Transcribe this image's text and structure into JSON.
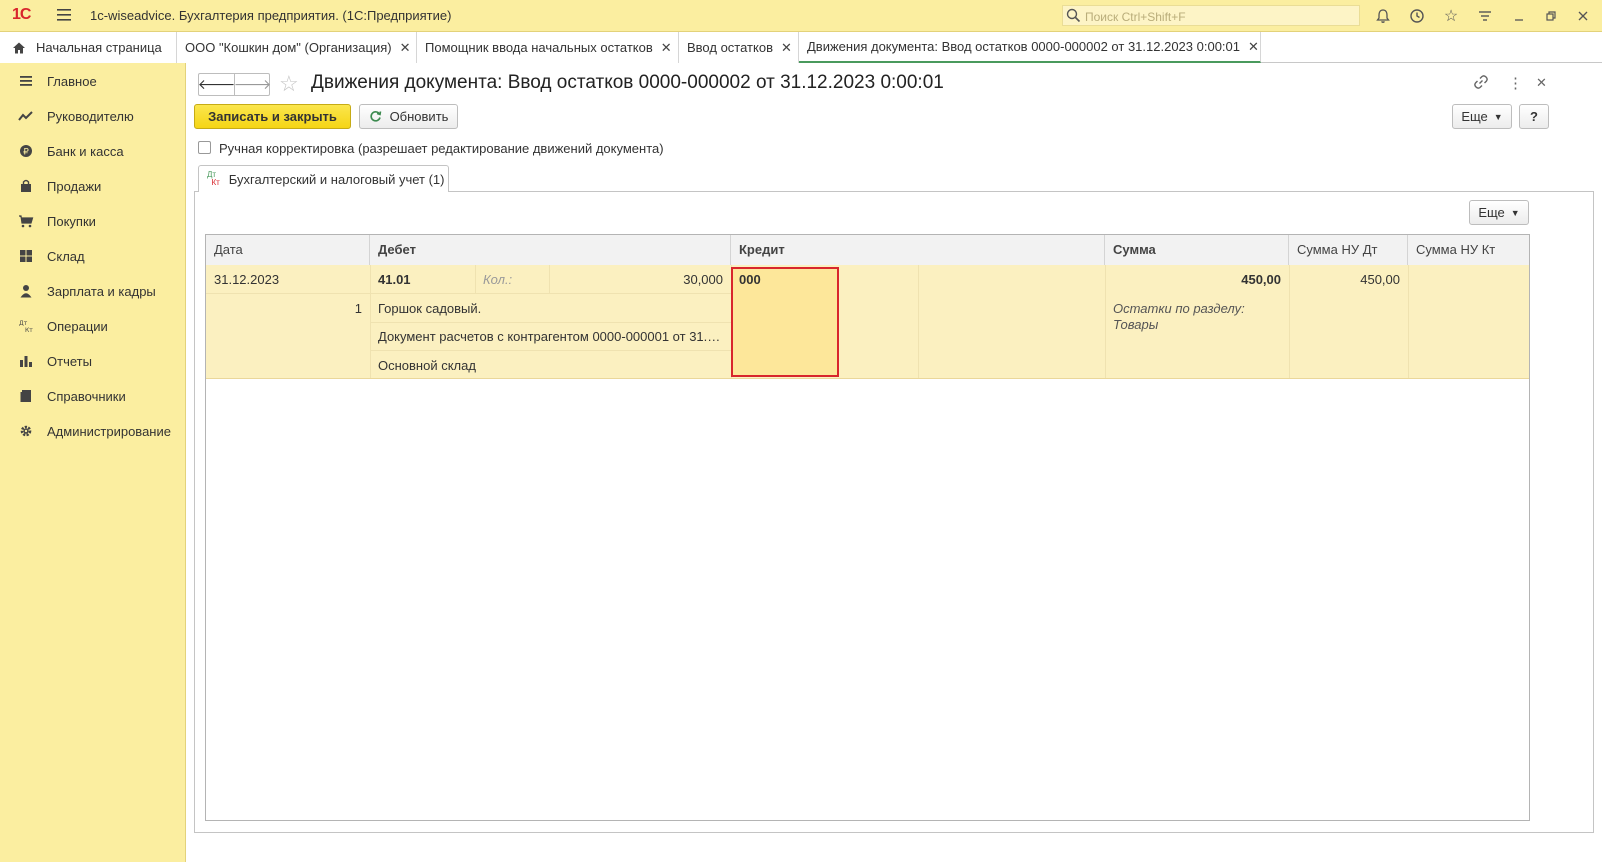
{
  "titlebar": {
    "logo": "1С",
    "title": "1c-wiseadvice. Бухгалтерия предприятия.  (1С:Предприятие)",
    "search_placeholder": "Поиск Ctrl+Shift+F"
  },
  "tabs": [
    {
      "label": "Начальная страница"
    },
    {
      "label": "ООО \"Кошкин дом\" (Организация)"
    },
    {
      "label": "Помощник ввода начальных остатков"
    },
    {
      "label": "Ввод остатков"
    },
    {
      "label": "Движения документа: Ввод остатков 0000-000002 от 31.12.2023 0:00:01"
    }
  ],
  "sidebar": {
    "items": [
      {
        "label": "Главное"
      },
      {
        "label": "Руководителю"
      },
      {
        "label": "Банк и касса"
      },
      {
        "label": "Продажи"
      },
      {
        "label": "Покупки"
      },
      {
        "label": "Склад"
      },
      {
        "label": "Зарплата и кадры"
      },
      {
        "label": "Операции"
      },
      {
        "label": "Отчеты"
      },
      {
        "label": "Справочники"
      },
      {
        "label": "Администрирование"
      }
    ]
  },
  "main": {
    "title": "Движения документа: Ввод остатков 0000-000002 от 31.12.2023 0:00:01",
    "save_close_label": "Записать и закрыть",
    "refresh_label": "Обновить",
    "more_label": "Еще",
    "help_label": "?",
    "manual_edit_label": "Ручная корректировка (разрешает редактирование движений документа)",
    "tab_label": "Бухгалтерский и налоговый учет (1)",
    "tab_icon_top": "Дт",
    "tab_icon_bottom": "Кт",
    "grid_more_label": "Еще"
  },
  "grid": {
    "headers": [
      "Дата",
      "Дебет",
      "Кредит",
      "Сумма",
      "Сумма НУ Дт",
      "Сумма НУ Кт"
    ],
    "row": {
      "date": "31.12.2023",
      "number": "1",
      "debit_account": "41.01",
      "qty_label": "Кол.:",
      "qty_value": "30,000",
      "subconto1": "Горшок садовый.",
      "subconto2": "Документ расчетов с контрагентом 0000-000001 от 31.12...",
      "subconto3": "Основной склад",
      "credit_account": "000",
      "sum": "450,00",
      "content_line1": "Остатки по разделу:",
      "content_line2": "Товары",
      "sum_nu_dt": "450,00",
      "sum_nu_kt": ""
    }
  },
  "colors": {
    "accent_yellow": "#fbeea0",
    "selection_border": "#d8262c",
    "row_highlight": "#fbf0c0"
  }
}
